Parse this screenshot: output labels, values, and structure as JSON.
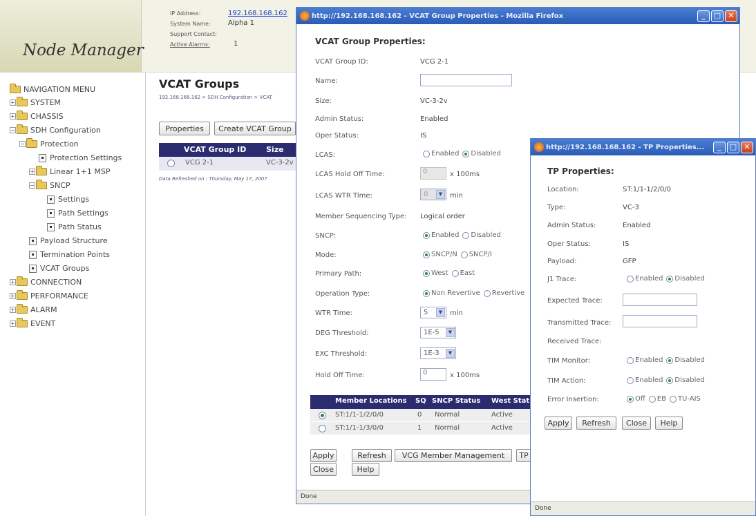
{
  "base": {
    "app_title": "Node Manager",
    "info": {
      "ip_label": "IP Address:",
      "ip_value": "192.168.168.162",
      "sysname_label": "System Name:",
      "sysname_value": "Alpha 1",
      "contact_label": "Support Contact:",
      "contact_value": "",
      "alarms_label": "Active Alarms:",
      "alarms_value": "1"
    },
    "nav": {
      "root": "NAVIGATION MENU",
      "items": [
        "SYSTEM",
        "CHASSIS",
        "SDH Configuration",
        "Protection",
        "Protection Settings",
        "Linear 1+1 MSP",
        "SNCP",
        "Settings",
        "Path Settings",
        "Path Status",
        "Payload Structure",
        "Termination Points",
        "VCAT Groups",
        "CONNECTION",
        "PERFORMANCE",
        "ALARM",
        "EVENT"
      ]
    },
    "page_title": "VCAT Groups",
    "breadcrumb": "192.168.168.162 > SDH Configuration > VCAT",
    "buttons": {
      "properties": "Properties",
      "create": "Create VCAT Group"
    },
    "table": {
      "col1": "VCAT Group ID",
      "col2": "Size",
      "row_id": "VCG 2-1",
      "row_size": "VC-3-2v"
    },
    "refresh_note": "Data Refreshed on : Thursday, May 17, 2007"
  },
  "win1": {
    "title": "http://192.168.168.162 - VCAT Group Properties - Mozilla Firefox",
    "heading": "VCAT Group Properties:",
    "fields": {
      "group_id_label": "VCAT Group ID:",
      "group_id_value": "VCG 2-1",
      "name_label": "Name:",
      "size_label": "Size:",
      "size_value": "VC-3-2v",
      "admin_label": "Admin Status:",
      "admin_value": "Enabled",
      "oper_label": "Oper Status:",
      "oper_value": "IS",
      "lcas_label": "LCAS:",
      "lcas_opt1": "Enabled",
      "lcas_opt2": "Disabled",
      "hold_label": "LCAS Hold Off Time:",
      "hold_value": "0",
      "hold_unit": "x 100ms",
      "wtr_label": "LCAS WTR Time:",
      "wtr_value": "0",
      "wtr_unit": "min",
      "seq_label": "Member Sequencing Type:",
      "seq_value": "Logical order",
      "sncp_label": "SNCP:",
      "sncp_opt1": "Enabled",
      "sncp_opt2": "Disabled",
      "mode_label": "Mode:",
      "mode_opt1": "SNCP/N",
      "mode_opt2": "SNCP/I",
      "primary_label": "Primary Path:",
      "primary_opt1": "West",
      "primary_opt2": "East",
      "optype_label": "Operation Type:",
      "optype_opt1": "Non Revertive",
      "optype_opt2": "Revertive",
      "wtrtime_label": "WTR Time:",
      "wtrtime_value": "5",
      "wtrtime_unit": "min",
      "deg_label": "DEG Threshold:",
      "deg_value": "1E-5",
      "exc_label": "EXC Threshold:",
      "exc_value": "1E-3",
      "holdoff_label": "Hold Off Time:",
      "holdoff_value": "0",
      "holdoff_unit": "x 100ms"
    },
    "members": {
      "headers": [
        "Member Locations",
        "SQ",
        "SNCP Status",
        "West Stat"
      ],
      "rows": [
        {
          "loc": "ST:1/1-1/2/0/0",
          "sq": "0",
          "sncp": "Normal",
          "west": "Active"
        },
        {
          "loc": "ST:1/1-1/3/0/0",
          "sq": "1",
          "sncp": "Normal",
          "west": "Active"
        }
      ]
    },
    "buttons": {
      "apply": "Apply",
      "refresh": "Refresh",
      "vcg": "VCG Member Management",
      "tp": "TP",
      "close": "Close",
      "help": "Help"
    },
    "status": "Done"
  },
  "win2": {
    "title": "http://192.168.168.162 - TP Properties...",
    "heading": "TP Properties:",
    "fields": {
      "location_label": "Location:",
      "location_value": "ST:1/1-1/2/0/0",
      "type_label": "Type:",
      "type_value": "VC-3",
      "admin_label": "Admin Status:",
      "admin_value": "Enabled",
      "oper_label": "Oper Status:",
      "oper_value": "IS",
      "payload_label": "Payload:",
      "payload_value": "GFP",
      "j1_label": "J1 Trace:",
      "j1_opt1": "Enabled",
      "j1_opt2": "Disabled",
      "expected_label": "Expected Trace:",
      "transmitted_label": "Transmitted Trace:",
      "received_label": "Received Trace:",
      "timmon_label": "TIM Monitor:",
      "timmon_opt1": "Enabled",
      "timmon_opt2": "Disabled",
      "timact_label": "TIM Action:",
      "timact_opt1": "Enabled",
      "timact_opt2": "Disabled",
      "err_label": "Error Insertion:",
      "err_opt1": "Off",
      "err_opt2": "EB",
      "err_opt3": "TU-AIS"
    },
    "buttons": {
      "apply": "Apply",
      "refresh": "Refresh",
      "close": "Close",
      "help": "Help"
    },
    "status": "Done"
  }
}
